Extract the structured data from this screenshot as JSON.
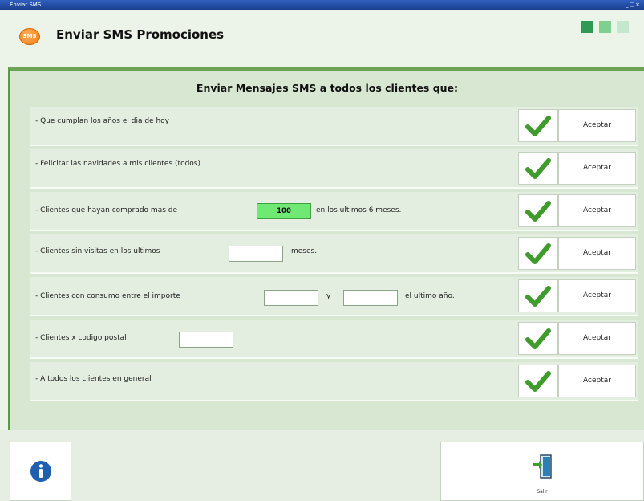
{
  "window": {
    "title": "Enviar SMS"
  },
  "header": {
    "logo_text": "SMS",
    "title": "Enviar SMS Promociones",
    "indicator_colors": [
      "#2f9a55",
      "#7fd08f",
      "#c4e8cc"
    ]
  },
  "panel": {
    "title": "Enviar Mensajes SMS a todos los clientes que:"
  },
  "rows": [
    {
      "label": "- Que cumplan los años el dia de hoy",
      "accept": "Aceptar"
    },
    {
      "label": "- Felicitar las navidades a mis clientes (todos)",
      "accept": "Aceptar"
    },
    {
      "label": "- Clientes que hayan comprado mas de",
      "amount_value": "100",
      "suffix": "en los ultimos 6 meses.",
      "accept": "Aceptar"
    },
    {
      "label": "- Clientes sin visitas en los ultimos",
      "months_value": "",
      "suffix": "meses.",
      "accept": "Aceptar"
    },
    {
      "label": "- Clientes con consumo entre el importe",
      "from_value": "",
      "conjunction": "y",
      "to_value": "",
      "suffix": "el ultimo año.",
      "accept": "Aceptar"
    },
    {
      "label": "- Clientes x codigo postal",
      "postal_value": "",
      "accept": "Aceptar"
    },
    {
      "label": "- A todos los clientes en general",
      "accept": "Aceptar"
    }
  ],
  "footer": {
    "info_icon": "info-icon",
    "exit_label": "Salir",
    "exit_icon": "exit-door-icon"
  },
  "colors": {
    "check_green": "#3f9b2c",
    "panel_green": "#d8e7d1",
    "accent_border": "#5a9a44",
    "amount_field": "#6fe874"
  }
}
